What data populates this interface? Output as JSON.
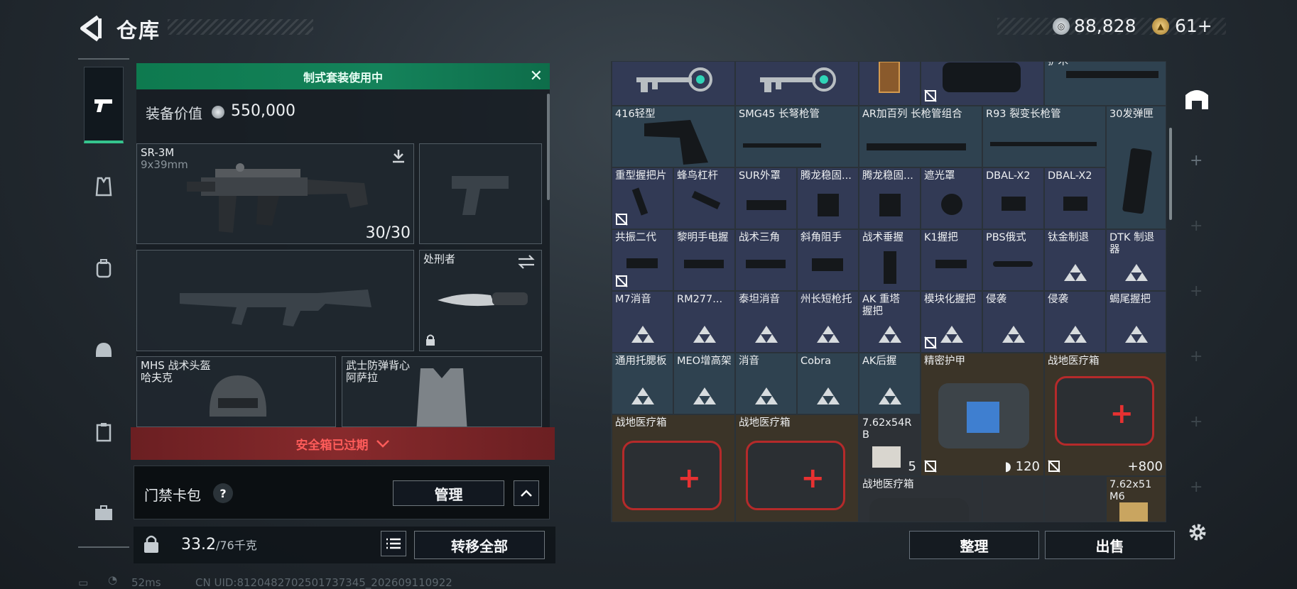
{
  "header": {
    "title": "仓库",
    "currency_silver": "88,828",
    "currency_gold": "61+"
  },
  "loadout": {
    "banner": "制式套装使用中",
    "value_label": "装备价值",
    "value": "550,000",
    "primary": {
      "name": "SR-3M",
      "caliber": "9x39mm",
      "ammo": "30/30"
    },
    "melee": {
      "name": "处刑者"
    },
    "helmet": {
      "name": "MHS 战术头盔",
      "sub": "哈夫克"
    },
    "armor": {
      "name": "武士防弹背心",
      "sub": "阿萨拉"
    },
    "safebox_warning": "安全箱已过期",
    "card_wallet": "门禁卡包",
    "question": "?",
    "manage_btn": "管理",
    "weight": "33.2",
    "weight_max": "/76千克",
    "transfer_btn": "转移全部"
  },
  "status": {
    "ping": "52ms",
    "uid": "CN UID:8120482702501737345_202609110922"
  },
  "inventory": {
    "row0": [
      "",
      "",
      "",
      "",
      "护木"
    ],
    "row1": [
      "416轻型",
      "SMG45 长弩枪管",
      "AR加百列 长枪管组合",
      "R93 裂变长枪管",
      "30发弹匣"
    ],
    "row2": [
      "重型握把片",
      "蜂鸟杠杆",
      "SUR外罩",
      "腾龙稳固...",
      "腾龙稳固...",
      "遮光罩",
      "DBAL-X2",
      "DBAL-X2"
    ],
    "row3": [
      "共振二代",
      "黎明手电握",
      "战术三角",
      "斜角阻手",
      "战术垂握",
      "K1握把",
      "PBS俄式",
      "钛金制退",
      "DTK 制退器"
    ],
    "row4": [
      "M7消音",
      "RM277...",
      "泰坦消音",
      "州长短枪托",
      "AK 重塔握把",
      "模块化握把",
      "侵袭",
      "侵袭",
      "蝎尾握把"
    ],
    "row5": [
      "通用托腮板",
      "MEO增高架",
      "消音",
      "Cobra",
      "AK后握",
      "精密护甲",
      "战地医疗箱"
    ],
    "row6": [
      "战地医疗箱",
      "战地医疗箱",
      "7.62x54R B",
      "战地医疗箱",
      "7.62x51 M6"
    ],
    "armor_dur": "120",
    "med_cap": "+800",
    "ammo_count": "5",
    "sort_btn": "整理",
    "sell_btn": "出售"
  }
}
